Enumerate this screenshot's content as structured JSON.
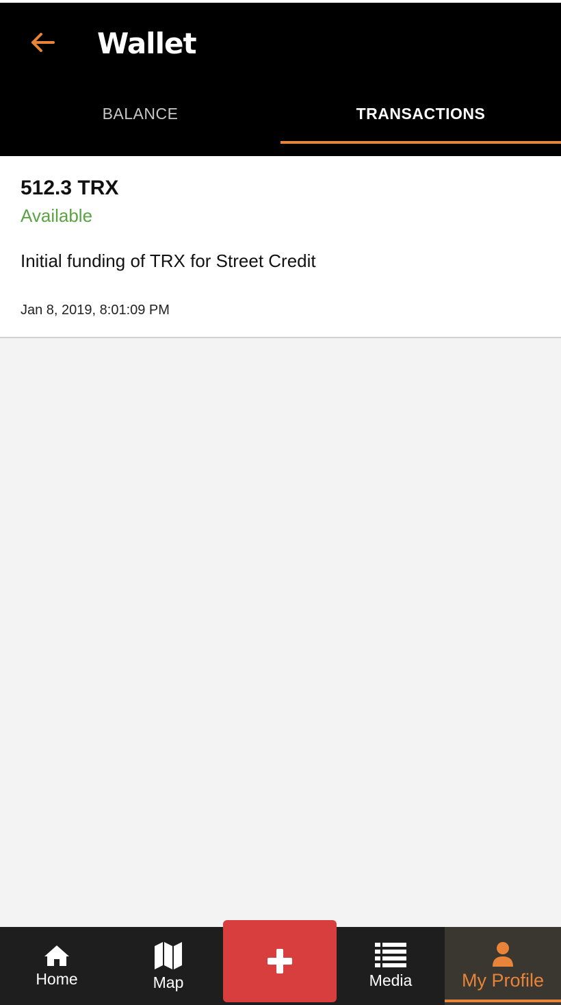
{
  "header": {
    "title": "Wallet",
    "back_icon": "arrow-left-icon",
    "accent_color": "#e8843a"
  },
  "tabs": [
    {
      "label": "BALANCE",
      "active": false
    },
    {
      "label": "TRANSACTIONS",
      "active": true
    }
  ],
  "transaction": {
    "amount": "512.3 TRX",
    "status": "Available",
    "status_color": "#5aa342",
    "description": "Initial funding of TRX for Street Credit",
    "timestamp": "Jan 8, 2019, 8:01:09 PM"
  },
  "bottom_nav": {
    "items": [
      {
        "label": "Home",
        "icon": "home-icon",
        "active": false
      },
      {
        "label": "Map",
        "icon": "map-icon",
        "active": false
      },
      {
        "label": "",
        "icon": "plus-icon",
        "active": false
      },
      {
        "label": "Media",
        "icon": "list-icon",
        "active": false
      },
      {
        "label": "My Profile",
        "icon": "user-icon",
        "active": true
      }
    ],
    "add_button_color": "#d93e3e"
  }
}
